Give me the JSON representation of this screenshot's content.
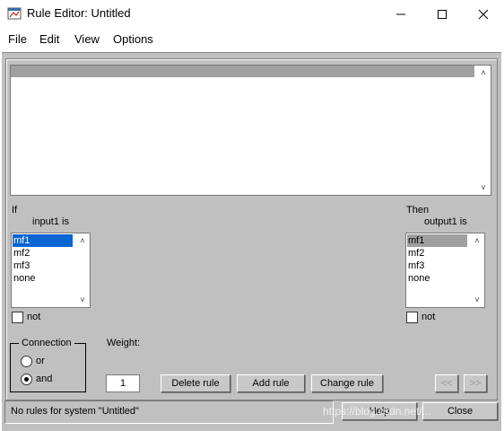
{
  "window": {
    "title": "Rule Editor: Untitled"
  },
  "menu": [
    "File",
    "Edit",
    "View",
    "Options"
  ],
  "antecedent": {
    "if_label": "If",
    "var_label": "input1 is",
    "items": [
      "mf1",
      "mf2",
      "mf3",
      "none"
    ],
    "selected": "mf1",
    "not_label": "not"
  },
  "consequent": {
    "then_label": "Then",
    "var_label": "output1 is",
    "items": [
      "mf1",
      "mf2",
      "mf3",
      "none"
    ],
    "selected": "mf1",
    "not_label": "not"
  },
  "connection": {
    "label": "Connection",
    "options": [
      "or",
      "and"
    ],
    "selected": "and"
  },
  "weight": {
    "label": "Weight:",
    "value": "1"
  },
  "buttons": {
    "delete": "Delete rule",
    "add": "Add rule",
    "change": "Change rule",
    "prev": "<<",
    "next": ">>",
    "help": "Help",
    "close": "Close"
  },
  "status": "No rules for system \"Untitled\"",
  "watermark": "https://blog.csdn.net/..."
}
